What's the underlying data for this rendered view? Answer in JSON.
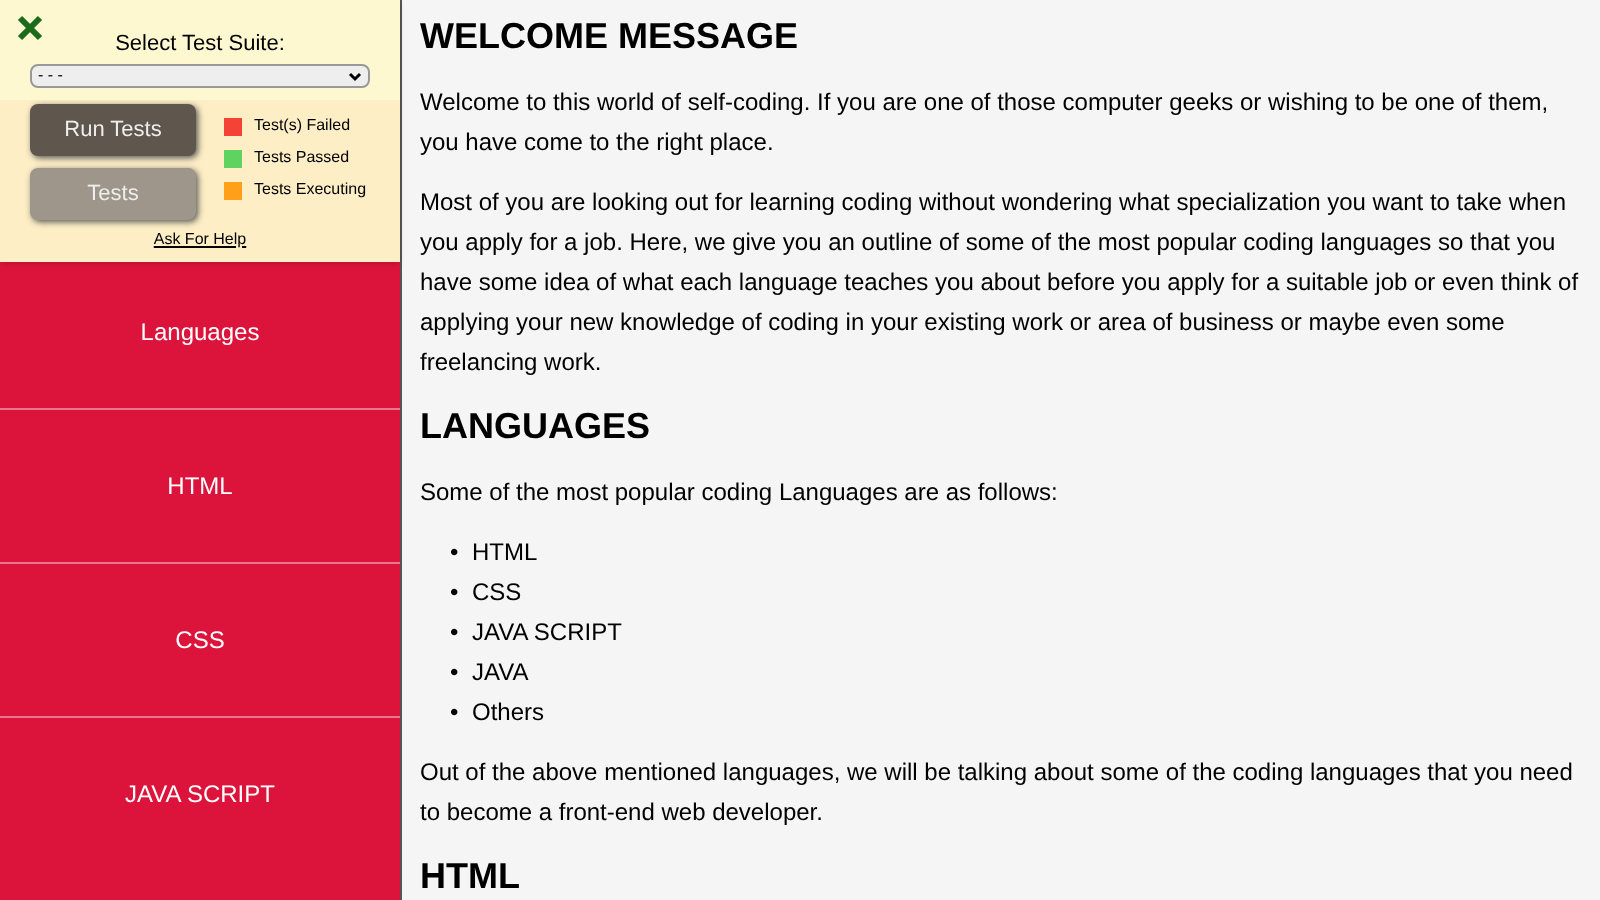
{
  "sidebar": {
    "items": [
      {
        "label": "Languages"
      },
      {
        "label": "HTML"
      },
      {
        "label": "CSS"
      },
      {
        "label": "JAVA SCRIPT"
      }
    ]
  },
  "test_panel": {
    "title": "Select Test Suite:",
    "suite_select": {
      "value": "- - -"
    },
    "buttons": [
      {
        "label": "Run Tests",
        "kind": "primary"
      },
      {
        "label": "Tests",
        "kind": "secondary"
      }
    ],
    "legend": [
      {
        "label": "Test(s) Failed",
        "color": "#f44336"
      },
      {
        "label": "Tests Passed",
        "color": "#5fd35f"
      },
      {
        "label": "Tests Executing",
        "color": "#ff9f1a"
      }
    ],
    "help_link": "Ask For Help"
  },
  "content": [
    {
      "kind": "heading",
      "text": "WELCOME MESSAGE"
    },
    {
      "kind": "paragraph",
      "text": "Welcome to this world of self-coding. If you are one of those computer geeks or wishing to be one of them, you have come to the right place."
    },
    {
      "kind": "paragraph",
      "text": "Most of you are looking out for learning coding without wondering what specialization you want to take when you apply for a job. Here, we give you an outline of some of the most popular coding languages so that you have some idea of what each language teaches you about before you apply for a suitable job or even think of applying your new knowledge of coding in your existing work or area of business or maybe even some freelancing work."
    },
    {
      "kind": "heading",
      "text": "LANGUAGES"
    },
    {
      "kind": "paragraph",
      "text": "Some of the most popular coding Languages are as follows:"
    },
    {
      "kind": "list",
      "marker": "•",
      "items": [
        "HTML",
        "CSS",
        "JAVA SCRIPT",
        "JAVA",
        "Others"
      ]
    },
    {
      "kind": "paragraph",
      "text": "Out of the above mentioned languages, we will be talking about some of the coding languages that you need to become a front-end web developer."
    },
    {
      "kind": "heading",
      "text": "HTML"
    }
  ]
}
